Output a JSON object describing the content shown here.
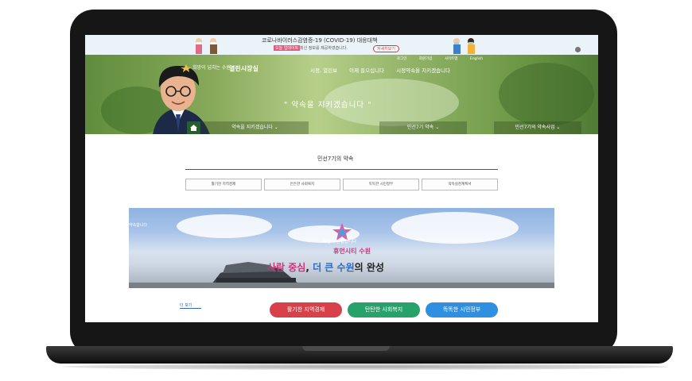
{
  "covid_banner": {
    "title": "코로나바이러스감염증-19 (COVID-19) 대응대책",
    "tag": "오늘 업데이트",
    "subtitle": "최신 정보를 제공하였습니다.",
    "button": "자세히보기"
  },
  "utility": [
    "로그인",
    "회원가입",
    "사이트맵",
    "English"
  ],
  "logo": {
    "text": "희망이 넘치는 수원",
    "title": "열린시장실"
  },
  "gnb": [
    "시정, 열린보",
    "이제 들으십니다",
    "시정약속을 지키겠습니다"
  ],
  "slogan": "\" 약속을 지키겠습니다 \"",
  "subnav": [
    "약속을 지키겠습니다",
    "민선7기 약속",
    "민선7기의 약속사업"
  ],
  "section_title": "민선7기의 약속",
  "tabs": [
    "활기찬 지역경제",
    "든든한 사회복지",
    "똑똑한 시민정부",
    "약속실천계획서"
  ],
  "photo": {
    "tag": "약속합니다",
    "small": "사람이 반갑습니다",
    "mid": "휴먼시티 수원",
    "slogan_a": "사람 중심",
    "slogan_b": "더 큰 수원",
    "slogan_c": "의 완성"
  },
  "more_link": "더 보기",
  "pills": [
    {
      "label": "활기찬 지역경제",
      "color": "#d9414a"
    },
    {
      "label": "탄탄한 사회복지",
      "color": "#26a26a"
    },
    {
      "label": "똑똑한 시민정부",
      "color": "#2f8fe0"
    }
  ]
}
